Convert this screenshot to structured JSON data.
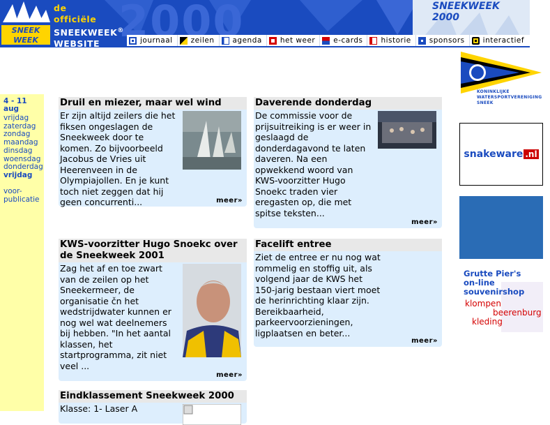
{
  "header": {
    "tagline_1": "de",
    "tagline_2": "officiële",
    "tagline_3": "SNEEKWEEK",
    "tagline_reg": "®",
    "tagline_4": "WEBSITE",
    "logo_word_1": "SNEEK",
    "logo_word_2": "WEEK",
    "year": "2000",
    "brand_title": "SNEEKWEEK 2000"
  },
  "nav": {
    "items": [
      {
        "label": "journaal",
        "icon": "journaal-flag-icon",
        "color": "#1a4bbf"
      },
      {
        "label": "zeilen",
        "icon": "zeilen-flag-icon",
        "color": "#000000"
      },
      {
        "label": "agenda",
        "icon": "agenda-flag-icon",
        "color": "#1a4bbf"
      },
      {
        "label": "het weer",
        "icon": "weer-flag-icon",
        "color": "#d40000"
      },
      {
        "label": "e-cards",
        "icon": "ecards-flag-icon",
        "color": "#d40000"
      },
      {
        "label": "historie",
        "icon": "historie-flag-icon",
        "color": "#d40000"
      },
      {
        "label": "sponsors",
        "icon": "sponsors-flag-icon",
        "color": "#1a4bbf"
      },
      {
        "label": "interactief",
        "icon": "interactief-flag-icon",
        "color": "#ffd400"
      }
    ]
  },
  "dates": {
    "range_1": "4 - 11",
    "range_2": "aug",
    "days": [
      {
        "label": "vrijdag",
        "active": false
      },
      {
        "label": "zaterdag",
        "active": false
      },
      {
        "label": "zondag",
        "active": false
      },
      {
        "label": "maandag",
        "active": false
      },
      {
        "label": "dinsdag",
        "active": false
      },
      {
        "label": "woensdag",
        "active": false
      },
      {
        "label": "donderdag",
        "active": false
      },
      {
        "label": "vrijdag",
        "active": true
      }
    ],
    "pub_1": "voor-",
    "pub_2": "publicatie"
  },
  "articles": [
    {
      "title": "Druil en miezer, maar wel wind",
      "body": "Er zijn altijd zeilers die het fiksen ongeslagen de Sneekweek door te komen. Zo bijvoorbeeld Jacobus de Vries uit Heerenveen in de Olympiajollen. En je kunt toch niet zeggen dat hij geen concurrenti...",
      "more": "meer»"
    },
    {
      "title": "Daverende donderdag",
      "body": "De commissie voor de prijsuitreiking is er weer in geslaagd de donderdagavond te laten daveren. Na een opwekkend woord van KWS-voorzitter Hugo Snoekc traden vier eregasten op, die met spitse teksten...",
      "more": "meer»"
    },
    {
      "title": "KWS-voorzitter Hugo Snoekc over de Sneekweek 2001",
      "body": "Zag het af en toe zwart van de zeilen op het Sneekermeer, de organisatie čn het wedstrijdwater kunnen er nog wel wat deelnemers bij hebben. \"In het aantal klassen, het startprogramma, zit niet veel ...",
      "more": "meer»"
    },
    {
      "title": "Facelift entree",
      "body": "Ziet de entree er nu nog wat rommelig en stoffig uit, als volgend jaar de KWS het 150-jarig bestaan viert moet de herinrichting klaar zijn. Bereikbaarheid, parkeervoorzieningen, ligplaatsen en beter...",
      "more": "meer»"
    },
    {
      "title": "Eindklassement Sneekweek 2000",
      "body": "Klasse: 1- Laser A"
    }
  ],
  "sidebar": {
    "kws_line_1": "KONINKLIJKE",
    "kws_line_2": "WATERSPORTVERENIGING",
    "kws_line_3": "SNEEK",
    "snakeware_word": "snakeware",
    "snakeware_tld": ".nl",
    "souvenir_1": "Grutte Pier's",
    "souvenir_2": "on-line",
    "souvenir_3": "souvenirshop",
    "souvenir_4": "klompen",
    "souvenir_5": "beerenburg",
    "souvenir_6": "kleding"
  }
}
